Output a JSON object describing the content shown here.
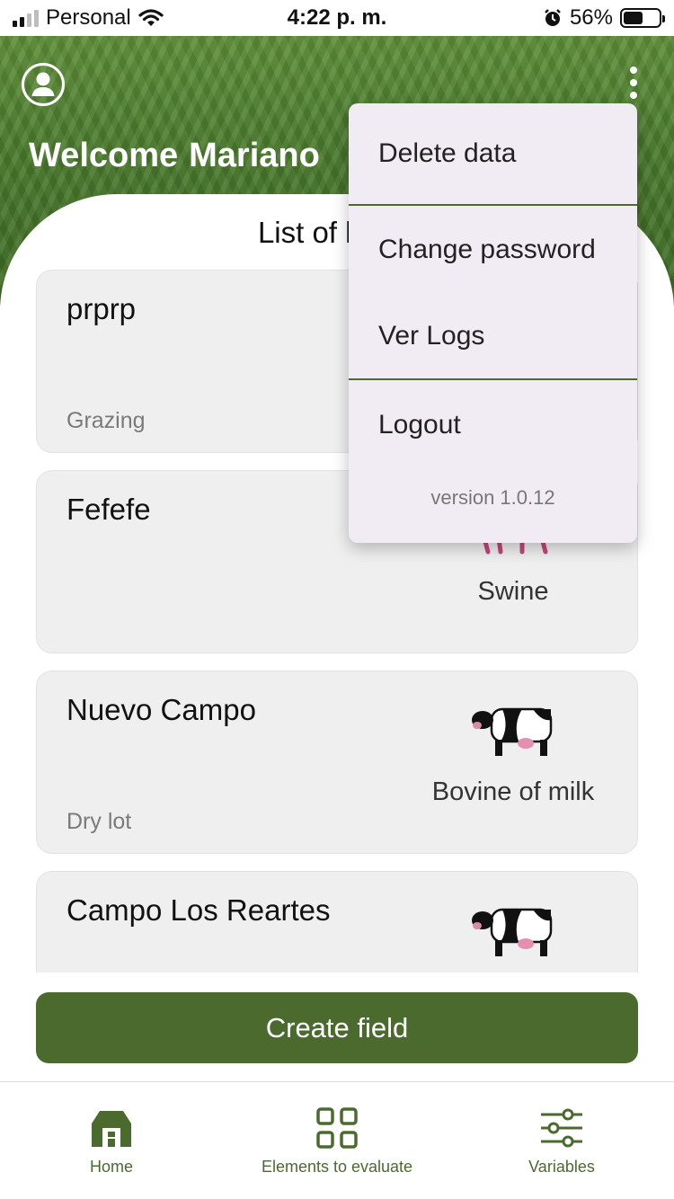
{
  "status_bar": {
    "carrier": "Personal",
    "time": "4:22 p. m.",
    "battery": "56%",
    "battery_level": 0.56
  },
  "header": {
    "welcome": "Welcome",
    "user_name": "Mariano",
    "avatar_icon": "account-circle-icon",
    "menu_icon": "more-vert-icon"
  },
  "list_title": "List of loads",
  "fields": [
    {
      "name": "prprp",
      "type": "Grazing",
      "animal": "",
      "icon": ""
    },
    {
      "name": "Fefefe",
      "type": "",
      "animal": "Swine",
      "icon": "pig-icon"
    },
    {
      "name": "Nuevo Campo",
      "type": "Dry lot",
      "animal": "Bovine of milk",
      "icon": "dairy-cow-icon"
    },
    {
      "name": "Campo Los Reartes",
      "type": "",
      "animal": "",
      "icon": "dairy-cow-icon"
    }
  ],
  "create_button": "Create field",
  "bottom_nav": [
    {
      "label": "Home",
      "icon": "home-barn-icon"
    },
    {
      "label": "Elements to evaluate",
      "icon": "grid-icon"
    },
    {
      "label": "Variables",
      "icon": "sliders-icon"
    }
  ],
  "menu": {
    "items": [
      "Delete data",
      "Change password",
      "Ver Logs",
      "Logout"
    ],
    "version": "version 1.0.12"
  },
  "colors": {
    "primary": "#4b6b2e",
    "menu_bg": "#f1ecf4",
    "card_bg": "#efefef"
  }
}
